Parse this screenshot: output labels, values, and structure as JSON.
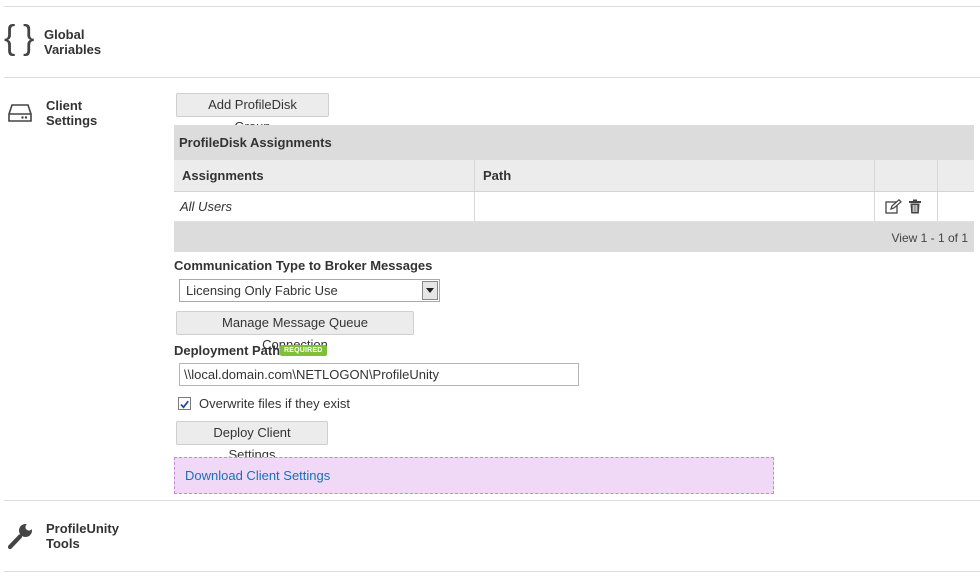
{
  "sections": {
    "global": {
      "label_line1": "Global",
      "label_line2": "Variables",
      "icon": "braces-icon"
    },
    "client": {
      "label_line1": "Client",
      "label_line2": "Settings",
      "icon": "hard-drive-icon"
    },
    "tools": {
      "label_line1": "ProfileUnity",
      "label_line2": "Tools",
      "icon": "wrench-icon"
    }
  },
  "buttons": {
    "add_group": "Add ProfileDisk Group",
    "manage_queue": "Manage Message Queue Connection",
    "deploy": "Deploy Client Settings"
  },
  "grid": {
    "caption": "ProfileDisk Assignments",
    "columns": [
      "Assignments",
      "Path",
      "",
      ""
    ],
    "rows": [
      {
        "assignment": "All Users",
        "path": ""
      }
    ],
    "footer": "View 1 - 1 of 1",
    "row_actions": [
      "edit-icon",
      "trash-icon"
    ]
  },
  "communication": {
    "label": "Communication Type to Broker Messages",
    "selected": "Licensing Only Fabric Use"
  },
  "deployment": {
    "label": "Deployment Path",
    "badge": "REQUIRED",
    "value": "\\\\local.domain.com\\NETLOGON\\ProfileUnity"
  },
  "overwrite": {
    "label": "Overwrite files if they exist",
    "checked": true
  },
  "download": {
    "link": "Download Client Settings"
  },
  "colors": {
    "accent_link": "#1a6fb8",
    "required_badge": "#7fbf3a",
    "download_bg": "#f0d9f7"
  }
}
